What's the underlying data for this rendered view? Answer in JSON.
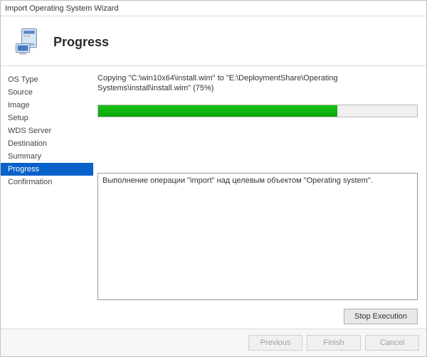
{
  "window": {
    "title": "Import Operating System Wizard"
  },
  "header": {
    "title": "Progress"
  },
  "sidebar": {
    "items": [
      {
        "label": "OS Type",
        "active": false
      },
      {
        "label": "Source",
        "active": false
      },
      {
        "label": "Image",
        "active": false
      },
      {
        "label": "Setup",
        "active": false
      },
      {
        "label": "WDS Server",
        "active": false
      },
      {
        "label": "Destination",
        "active": false
      },
      {
        "label": "Summary",
        "active": false
      },
      {
        "label": "Progress",
        "active": true
      },
      {
        "label": "Confirmation",
        "active": false
      }
    ]
  },
  "main": {
    "status_text": "Copying \"C:\\win10x64\\install.wim\" to \"E:\\DeploymentShare\\Operating Systems\\install\\install.wim\" (75%)",
    "progress_percent": 75,
    "log_text": "Выполнение операции \"import\" над целевым объектом \"Operating system\".",
    "stop_button": "Stop Execution"
  },
  "footer": {
    "previous": "Previous",
    "finish": "Finish",
    "cancel": "Cancel"
  }
}
